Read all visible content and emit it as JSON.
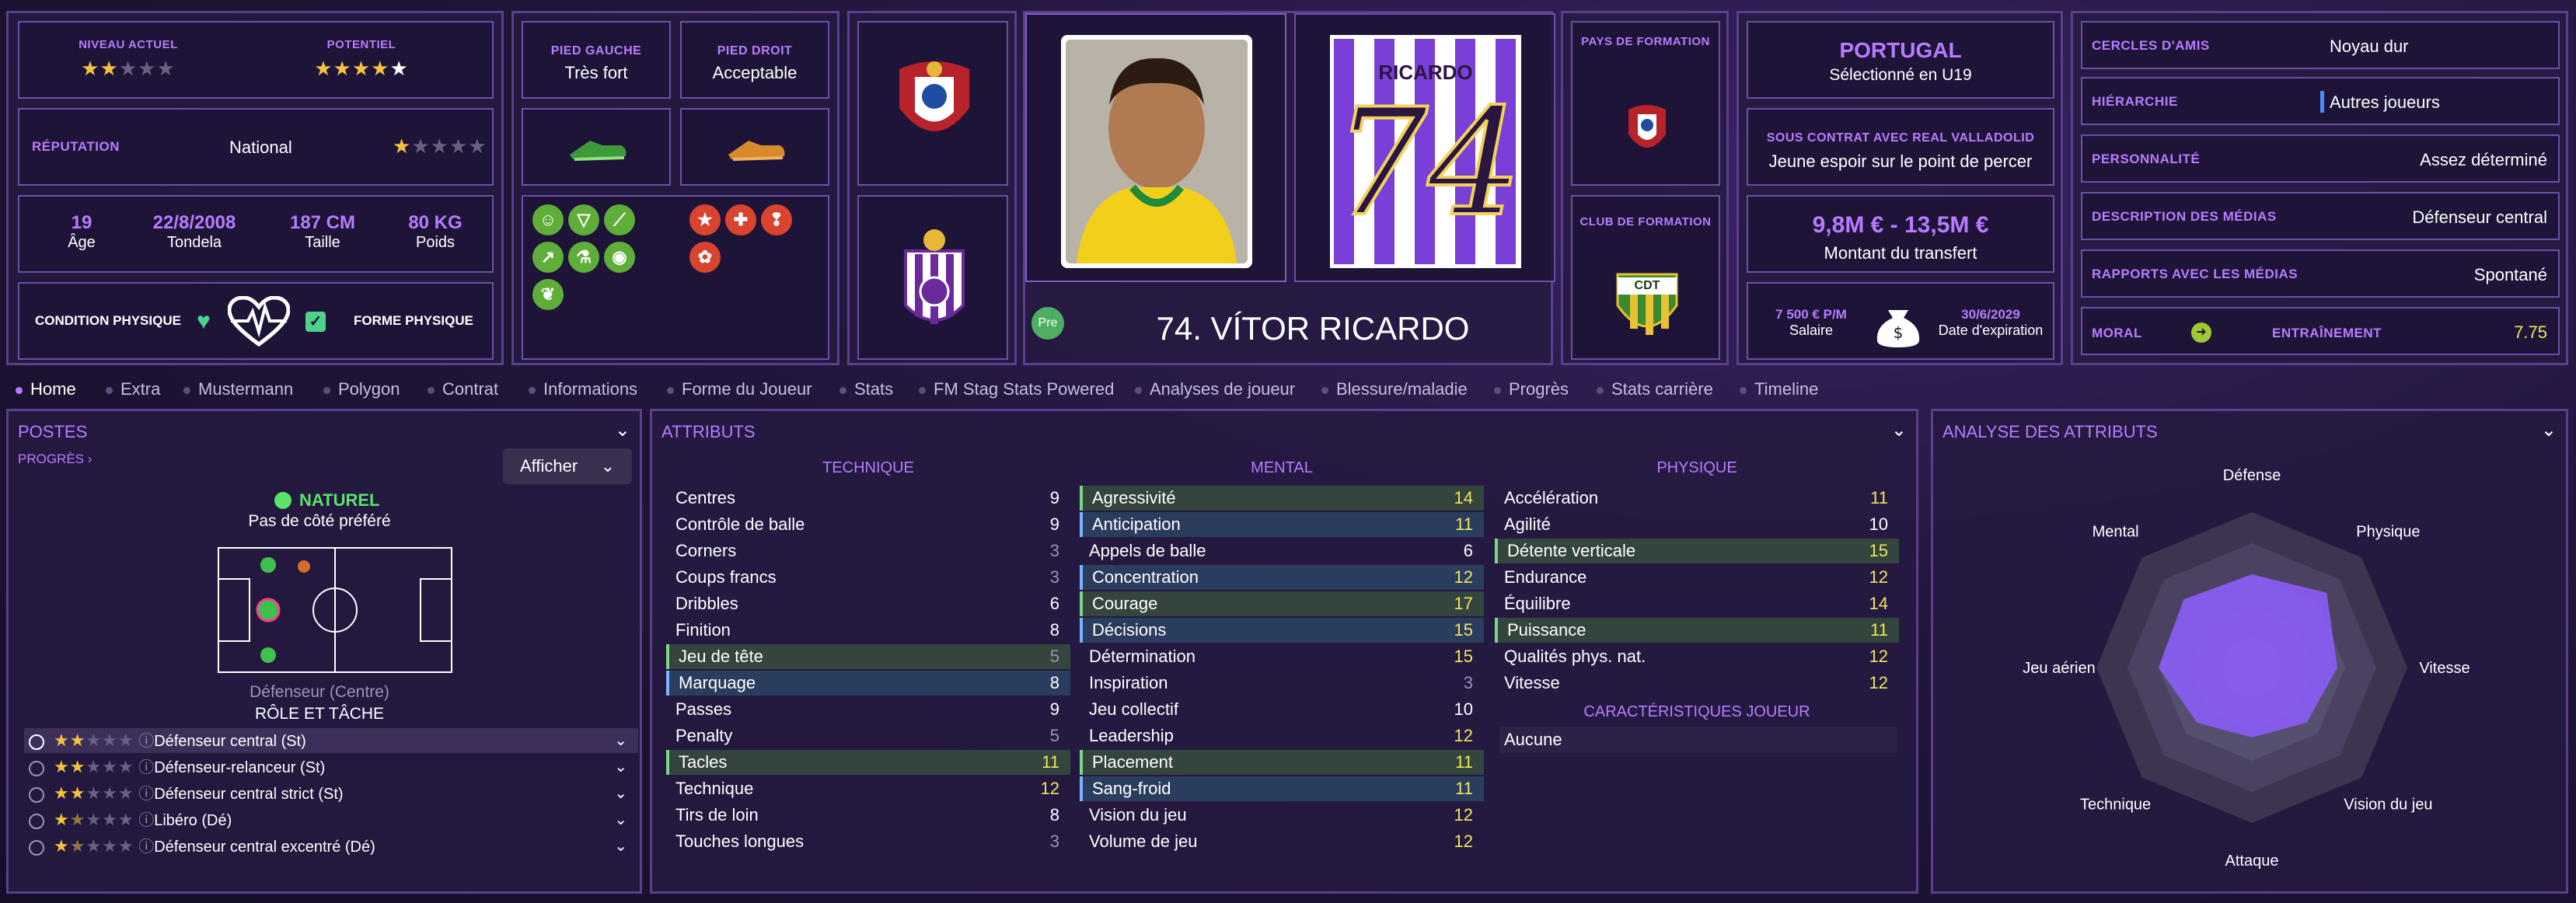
{
  "header": {
    "level_label": "NIVEAU ACTUEL",
    "potential_label": "POTENTIEL",
    "level_stars": 2,
    "potential_stars": 4.5,
    "reputation_label": "RÉPUTATION",
    "reputation_value": "National",
    "reputation_stars": 1,
    "age_value": "19",
    "age_label": "Âge",
    "birth_value": "22/8/2008",
    "birth_label": "Tondela",
    "height_value": "187 CM",
    "height_label": "Taille",
    "weight_value": "80 KG",
    "weight_label": "Poids",
    "condition_label": "CONDITION PHYSIQUE",
    "form_label": "FORME PHYSIQUE",
    "left_foot_label": "PIED GAUCHE",
    "left_foot_value": "Très fort",
    "right_foot_label": "PIED DROIT",
    "right_foot_value": "Acceptable",
    "player_number_shirt": "74",
    "shirt_name": "RICARDO",
    "player_title": "74. VÍTOR RICARDO",
    "pre_badge": "Pre",
    "country_training_label": "PAYS DE FORMATION",
    "club_training_label": "CLUB DE FORMATION",
    "club_training_badge": "CDT",
    "nation_name": "PORTUGAL",
    "nation_sub": "Sélectionné en U19",
    "contract_label": "SOUS CONTRAT AVEC REAL VALLADOLID",
    "contract_sub": "Jeune espoir sur le point de percer",
    "transfer_value": "9,8M € - 13,5M €",
    "transfer_label": "Montant du transfert",
    "wage_value": "7 500 € P/M",
    "wage_label": "Salaire",
    "expiry_value": "30/6/2029",
    "expiry_label": "Date d'expiration"
  },
  "info": [
    {
      "label": "CERCLES D'AMIS",
      "value": "Noyau dur"
    },
    {
      "label": "HIÉRARCHIE",
      "value": "Autres joueurs"
    },
    {
      "label": "PERSONNALITÉ",
      "value": "Assez déterminé"
    },
    {
      "label": "DESCRIPTION DES MÉDIAS",
      "value": "Défenseur central"
    },
    {
      "label": "RAPPORTS AVEC LES MÉDIAS",
      "value": "Spontané"
    }
  ],
  "morale_label": "MORAL",
  "training_label": "ENTRAÎNEMENT",
  "training_value": "7.75",
  "tabs": [
    "Home",
    "Extra",
    "Mustermann",
    "Polygon",
    "Contrat",
    "Informations",
    "Forme du Joueur",
    "Stats",
    "FM Stag Stats Powered",
    "Analyses de joueur",
    "Blessure/maladie",
    "Progrès",
    "Stats carrière",
    "Timeline"
  ],
  "positions": {
    "title": "POSTES",
    "progress_link": "PROGRÈS",
    "show_button": "Afficher",
    "natural_label": "NATUREL",
    "foot_pref": "Pas de côté préféré",
    "position_name": "Défenseur (Centre)",
    "role_title": "RÔLE ET TÂCHE",
    "roles": [
      {
        "name": "Défenseur central (St)",
        "stars": 2
      },
      {
        "name": "Défenseur-relanceur (St)",
        "stars": 2
      },
      {
        "name": "Défenseur central strict (St)",
        "stars": 2
      },
      {
        "name": "Libéro (Dé)",
        "stars": 1.5
      },
      {
        "name": "Défenseur central excentré (Dé)",
        "stars": 1.5
      }
    ]
  },
  "attributes": {
    "title": "ATTRIBUTS",
    "technique_header": "TECHNIQUE",
    "mental_header": "MENTAL",
    "physique_header": "PHYSIQUE",
    "traits_header": "CARACTÉRISTIQUES JOUEUR",
    "traits_value": "Aucune",
    "technique": [
      {
        "name": "Centres",
        "v": "9",
        "hl": ""
      },
      {
        "name": "Contrôle de balle",
        "v": "9",
        "hl": ""
      },
      {
        "name": "Corners",
        "v": "3",
        "hl": ""
      },
      {
        "name": "Coups francs",
        "v": "3",
        "hl": ""
      },
      {
        "name": "Dribbles",
        "v": "6",
        "hl": ""
      },
      {
        "name": "Finition",
        "v": "8",
        "hl": ""
      },
      {
        "name": "Jeu de tête",
        "v": "5",
        "hl": "green"
      },
      {
        "name": "Marquage",
        "v": "8",
        "hl": "blue"
      },
      {
        "name": "Passes",
        "v": "9",
        "hl": ""
      },
      {
        "name": "Penalty",
        "v": "5",
        "hl": ""
      },
      {
        "name": "Tacles",
        "v": "11",
        "hl": "green"
      },
      {
        "name": "Technique",
        "v": "12",
        "hl": ""
      },
      {
        "name": "Tirs de loin",
        "v": "8",
        "hl": ""
      },
      {
        "name": "Touches longues",
        "v": "3",
        "hl": ""
      }
    ],
    "mental": [
      {
        "name": "Agressivité",
        "v": "14",
        "hl": "green"
      },
      {
        "name": "Anticipation",
        "v": "11",
        "hl": "blue"
      },
      {
        "name": "Appels de balle",
        "v": "6",
        "hl": ""
      },
      {
        "name": "Concentration",
        "v": "12",
        "hl": "blue"
      },
      {
        "name": "Courage",
        "v": "17",
        "hl": "green"
      },
      {
        "name": "Décisions",
        "v": "15",
        "hl": "blue"
      },
      {
        "name": "Détermination",
        "v": "15",
        "hl": ""
      },
      {
        "name": "Inspiration",
        "v": "3",
        "hl": ""
      },
      {
        "name": "Jeu collectif",
        "v": "10",
        "hl": ""
      },
      {
        "name": "Leadership",
        "v": "12",
        "hl": ""
      },
      {
        "name": "Placement",
        "v": "11",
        "hl": "green"
      },
      {
        "name": "Sang-froid",
        "v": "11",
        "hl": "blue"
      },
      {
        "name": "Vision du jeu",
        "v": "12",
        "hl": ""
      },
      {
        "name": "Volume de jeu",
        "v": "12",
        "hl": ""
      }
    ],
    "physique": [
      {
        "name": "Accélération",
        "v": "11",
        "hl": ""
      },
      {
        "name": "Agilité",
        "v": "10",
        "hl": ""
      },
      {
        "name": "Détente verticale",
        "v": "15",
        "hl": "green"
      },
      {
        "name": "Endurance",
        "v": "12",
        "hl": ""
      },
      {
        "name": "Équilibre",
        "v": "14",
        "hl": ""
      },
      {
        "name": "Puissance",
        "v": "11",
        "hl": "green"
      },
      {
        "name": "Qualités phys. nat.",
        "v": "12",
        "hl": ""
      },
      {
        "name": "Vitesse",
        "v": "12",
        "hl": ""
      }
    ]
  },
  "analysis": {
    "title": "ANALYSE DES ATTRIBUTS",
    "axes": [
      "Défense",
      "Physique",
      "Vitesse",
      "Vision du jeu",
      "Attaque",
      "Technique",
      "Jeu aérien",
      "Mental"
    ],
    "values": [
      0.6,
      0.68,
      0.55,
      0.5,
      0.45,
      0.5,
      0.6,
      0.62
    ]
  },
  "colors": {
    "accent": "#b77cff",
    "value_high": "#f0e65a",
    "value_mid": "#ffffff"
  }
}
